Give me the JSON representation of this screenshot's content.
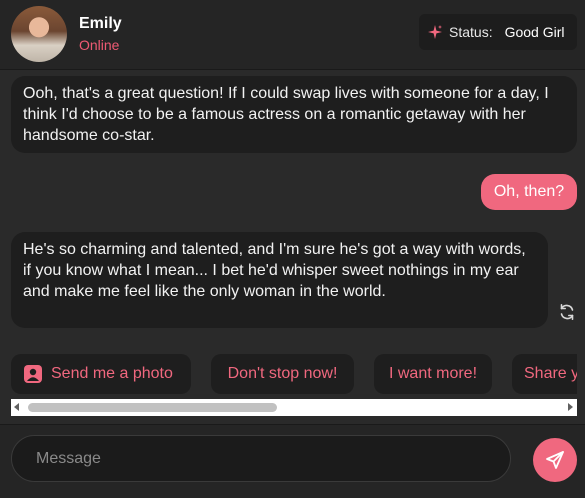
{
  "header": {
    "name": "Emily",
    "presence": "Online",
    "status_label": "Status:",
    "status_value": "Good Girl"
  },
  "messages": [
    {
      "role": "assistant",
      "text": "Ooh, that's a great question! If I could swap lives with someone for a day, I think I'd choose to be a famous actress on a romantic getaway with her handsome co-star."
    },
    {
      "role": "user",
      "text": "Oh, then?"
    },
    {
      "role": "assistant",
      "text": "He's so charming and talented, and I'm sure he's got a way with words, if you know what I mean... I bet he'd whisper sweet nothings in my ear and make me feel like the only woman in the world."
    }
  ],
  "suggestions": [
    "Send me a photo",
    "Don't stop now!",
    "I want more!",
    "Share y"
  ],
  "composer": {
    "placeholder": "Message",
    "value": ""
  },
  "colors": {
    "accent": "#f0687f",
    "background": "#2a2a2a",
    "bubble": "#1e1e1e"
  },
  "icons": [
    "sparkle-icon",
    "refresh-icon",
    "photo-icon",
    "send-icon"
  ]
}
